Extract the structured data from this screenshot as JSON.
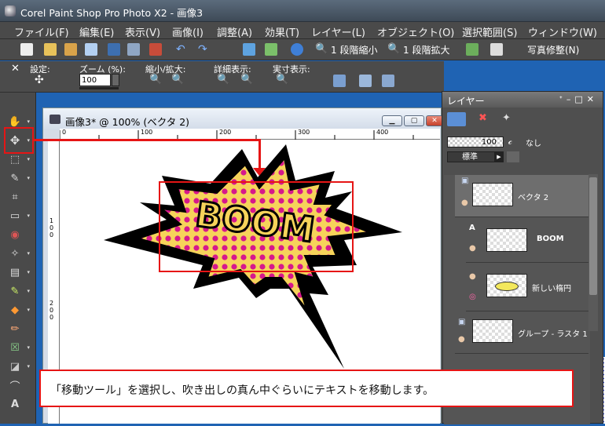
{
  "window": {
    "title": "Corel Paint Shop Pro Photo X2 - 画像3"
  },
  "menu": [
    "ファイル(F)",
    "編集(E)",
    "表示(V)",
    "画像(I)",
    "調整(A)",
    "効果(T)",
    "レイヤー(L)",
    "オブジェクト(O)",
    "選択範囲(S)",
    "ウィンドウ(W)"
  ],
  "toolbar": {
    "shrink_label": "1 段階縮小",
    "enlarge_label": "1 段階拡大",
    "photo_fix_label": "写真修整(N)"
  },
  "tool_options": {
    "settings_label": "設定:",
    "zoom_label": "ズーム (%):",
    "zoom_value": "100",
    "zoom_fit_label": "縮小/拡大:",
    "detail_label": "詳細表示:",
    "actual_label": "実寸表示:"
  },
  "document": {
    "title": "画像3* @ 100% (ベクタ 2)",
    "ruler_top": [
      "0",
      "100",
      "200",
      "300",
      "400"
    ],
    "ruler_left": [
      "1",
      "0",
      "0",
      "2",
      "0",
      "0"
    ],
    "bubble_text": "BOOM"
  },
  "layers_panel": {
    "title": "レイヤー",
    "opacity_value": "100",
    "none_label": "なし",
    "blend_mode": "標準",
    "layers": [
      {
        "name": "ベクタ 2",
        "selected": true
      },
      {
        "name": "BOOM",
        "selected": false
      },
      {
        "name": "新しい楕円",
        "selected": false
      },
      {
        "name": "グループ - ラスタ 1",
        "selected": false
      }
    ]
  },
  "callout": {
    "text": "「移動ツール」を選択し、吹き出しの真ん中ぐらいにテキストを移動します。"
  },
  "colors": {
    "annotation_red": "#e61515",
    "bubble_yellow": "#f6d35a",
    "dot_magenta": "#d6188c"
  }
}
